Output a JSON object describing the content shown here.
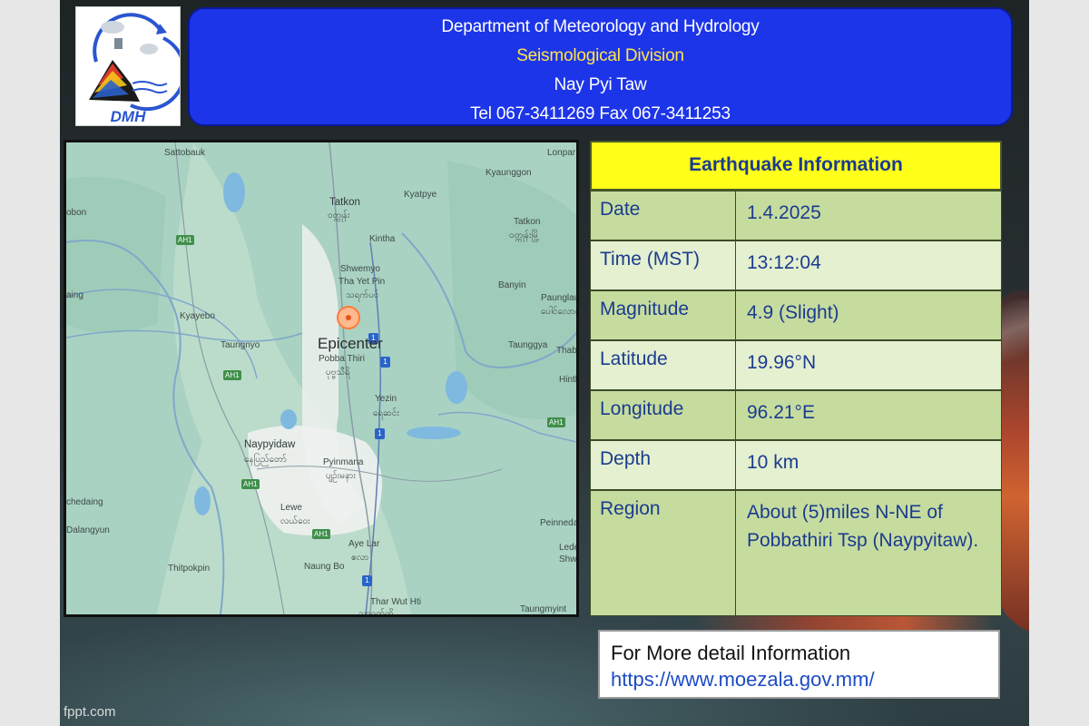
{
  "header": {
    "line1": "Department of Meteorology and Hydrology",
    "line2": "Seismological Division",
    "line3": "Nay Pyi Taw",
    "line4": "Tel 067-3411269 Fax 067-3411253"
  },
  "logo": {
    "text": "DMH"
  },
  "map": {
    "epicenter_label": "Epicenter",
    "places": [
      "Sattobauk",
      "Lonpar",
      "Kyaunggon",
      "Kyatpye",
      "Tatkon",
      "ဝတ္ကုန်း",
      "Tatkon",
      "ဝတ္ကုန်းမြို့",
      "Kintha",
      "obon",
      "Shwemyo",
      "Tha Yet Pin",
      "သရက်ပင်",
      "Banyin",
      "Paunglau",
      "ပေါင်လောင်",
      "aing",
      "Kyayebo",
      "Taungnyo",
      "Pobba Thiri",
      "ပုဗ္ဗသီရိ",
      "Taunggya",
      "Thaby",
      "Hinth",
      "Yezin",
      "ရေဆင်း",
      "Naypyidaw",
      "နေပြည်တော်",
      "Pyinmana",
      "ပျဉ်းမနား",
      "chedaing",
      "Dalangyun",
      "Lewe",
      "လယ်ဝေး",
      "Aye Lar",
      "ဧလာ",
      "Peinneda",
      "Lede",
      "Shwe",
      "Thitpokpin",
      "Naung Bo",
      "Thar Wut Hti",
      "သာဝတ်ထိ",
      "Taungmyint"
    ],
    "road_labels": [
      "AH1",
      "AH1",
      "AH1",
      "AH1",
      "AH1"
    ],
    "highway_labels": [
      "1",
      "1",
      "1",
      "1"
    ]
  },
  "info": {
    "title": "Earthquake Information",
    "rows": [
      {
        "label": "Date",
        "value": "1.4.2025"
      },
      {
        "label": "Time (MST)",
        "value": "13:12:04"
      },
      {
        "label": "Magnitude",
        "value": "4.9 (Slight)"
      },
      {
        "label": "Latitude",
        "value": "19.96°N"
      },
      {
        "label": "Longitude",
        "value": "96.21°E"
      },
      {
        "label": "Depth",
        "value": "10 km"
      },
      {
        "label": "Region",
        "value": "About (5)miles N-NE of Pobbathiri Tsp (Naypyitaw)."
      }
    ]
  },
  "more": {
    "text": "For More detail Information",
    "url": "https://www.moezala.gov.mm/"
  },
  "footer": {
    "credit": "fppt.com"
  },
  "colors": {
    "header_bg": "#1d35e8",
    "header_accent": "#ffe54a",
    "table_title_bg": "#ffff1a",
    "table_dark": "#c6dc9f",
    "table_light": "#e4f0cf",
    "table_text": "#1b3b8f",
    "epicenter": "#ff7a3a"
  }
}
